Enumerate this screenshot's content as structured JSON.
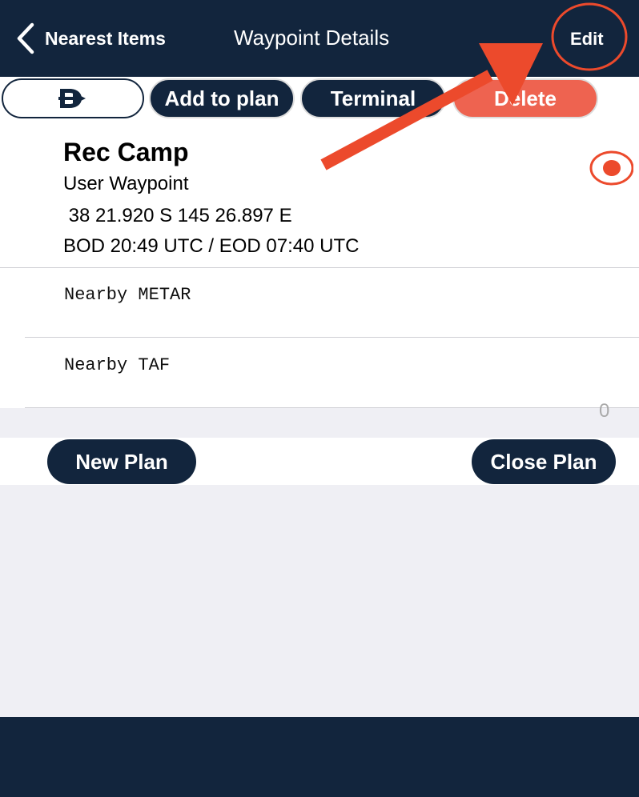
{
  "nav": {
    "back_label": "Nearest Items",
    "title": "Waypoint Details",
    "edit_label": "Edit"
  },
  "toolbar": {
    "direct_icon": "direct-to-icon",
    "add_label": "Add to plan",
    "terminal_label": "Terminal",
    "delete_label": "Delete"
  },
  "waypoint": {
    "name": "Rec Camp",
    "type": "User Waypoint",
    "coordinates": " 38 21.920 S 145 26.897 E",
    "daylight": "BOD 20:49 UTC / EOD 07:40 UTC"
  },
  "rows": {
    "metar": "Nearby METAR",
    "taf": "Nearby TAF"
  },
  "partial_value": "0",
  "plan": {
    "new_label": "New Plan",
    "close_label": "Close Plan"
  },
  "colors": {
    "navy": "#12253d",
    "accent_red": "#ee6350",
    "annotation_red": "#ec4a2c"
  }
}
